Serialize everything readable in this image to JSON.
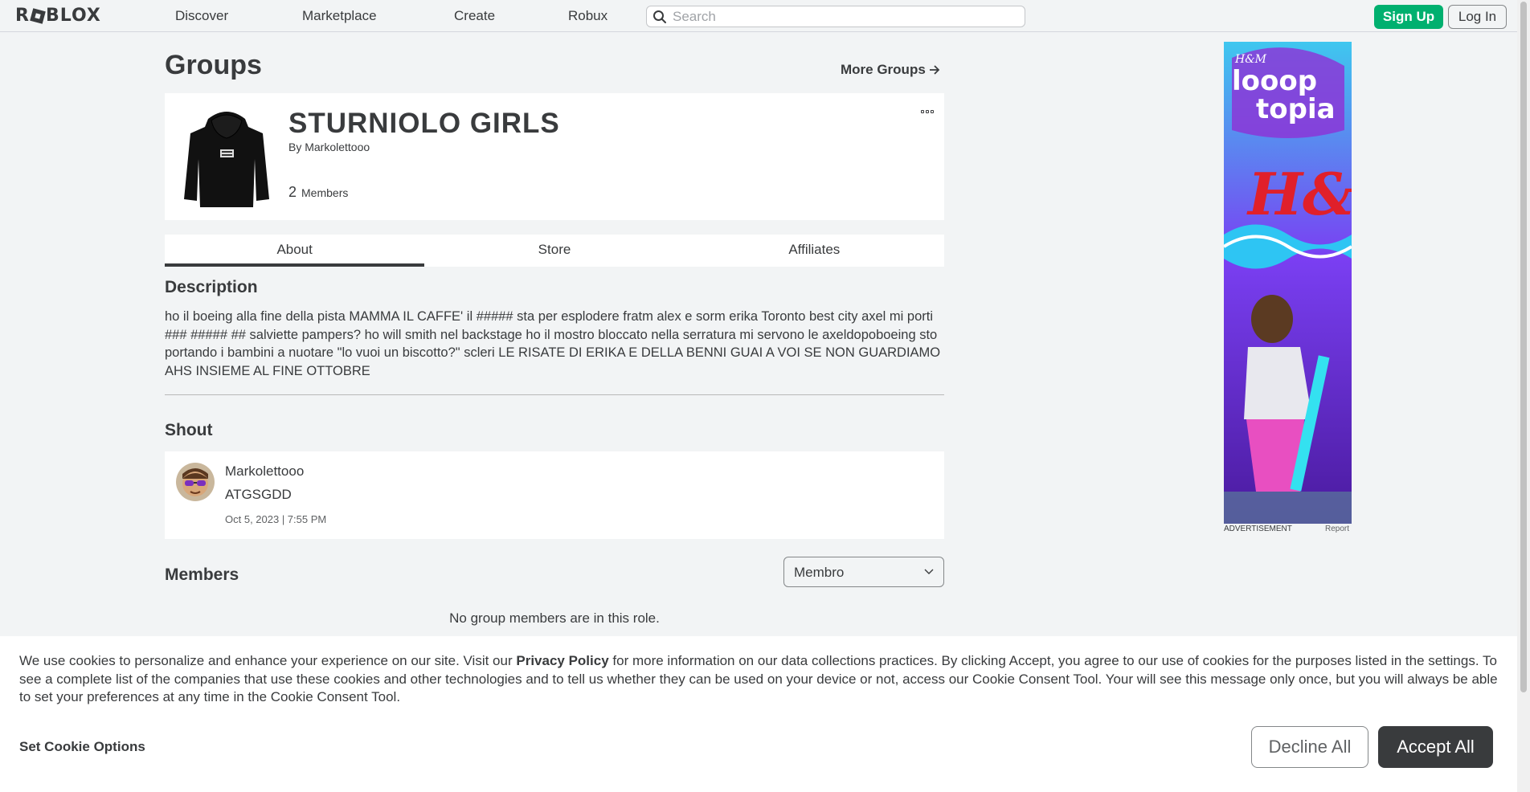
{
  "nav": {
    "logo": "ROBLOX",
    "links": [
      "Discover",
      "Marketplace",
      "Create",
      "Robux"
    ],
    "search_placeholder": "Search",
    "signup_label": "Sign Up",
    "login_label": "Log In"
  },
  "page": {
    "title": "Groups",
    "more_groups": "More Groups"
  },
  "group": {
    "name": "STURNIOLO GIRLS",
    "by_label": "By",
    "owner": "Markolettooo",
    "member_count": "2",
    "member_label": "Members"
  },
  "tabs": [
    "About",
    "Store",
    "Affiliates"
  ],
  "description": {
    "heading": "Description",
    "text": "ho il boeing alla fine della pista MAMMA IL CAFFE' il ##### sta per esplodere fratm alex e sorm erika Toronto best city axel mi porti ### ##### ## salviette pampers? ho will smith nel backstage ho il mostro bloccato nella serratura mi servono le axeldopoboeing sto portando i bambini a nuotare \"lo vuoi un biscotto?\" scleri LE RISATE DI ERIKA E DELLA BENNI GUAI A VOI SE NON GUARDIAMO AHS INSIEME AL FINE OTTOBRE"
  },
  "shout": {
    "heading": "Shout",
    "user": "Markolettooo",
    "body": "ATGSGDD",
    "time": "Oct 5, 2023 | 7:55 PM"
  },
  "members": {
    "heading": "Members",
    "role_selected": "Membro",
    "empty_text": "No group members are in this role."
  },
  "ad": {
    "label": "ADVERTISEMENT",
    "report": "Report",
    "brand_top": "H&M",
    "line1": "looop",
    "line2": "topia",
    "logo": "H&M"
  },
  "cookie": {
    "text_before": "We use cookies to personalize and enhance your experience on our site. Visit our ",
    "privacy_link": "Privacy Policy",
    "text_after": " for more information on our data collections practices. By clicking Accept, you agree to our use of cookies for the purposes listed in the settings. To see a complete list of the companies that use these cookies and other technologies and to tell us whether they can be used on your device or not, access our Cookie Consent Tool. Your will see this message only once, but you will always be able to set your preferences at any time in the Cookie Consent Tool.",
    "options_label": "Set Cookie Options",
    "decline_label": "Decline All",
    "accept_label": "Accept All"
  },
  "colors": {
    "signup_green": "#00b06f",
    "accept_dark": "#393b3d",
    "page_bg": "#f2f4f5"
  }
}
